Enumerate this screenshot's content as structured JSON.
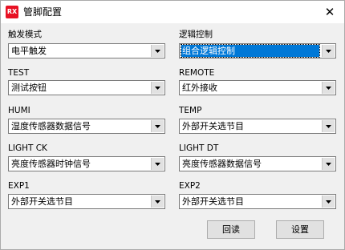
{
  "window": {
    "title": "管脚配置",
    "app_icon_text": "RX",
    "close_glyph": "✕"
  },
  "fields": {
    "trigger_mode": {
      "label": "触发模式",
      "value": "电平触发"
    },
    "logic_control": {
      "label": "逻辑控制",
      "value": "组合逻辑控制"
    },
    "test": {
      "label": "TEST",
      "value": "测试按钮"
    },
    "remote": {
      "label": "REMOTE",
      "value": "红外接收"
    },
    "humi": {
      "label": "HUMI",
      "value": "湿度传感器数据信号"
    },
    "temp": {
      "label": "TEMP",
      "value": "外部开关选节目"
    },
    "light_ck": {
      "label": "LIGHT CK",
      "value": "亮度传感器时钟信号"
    },
    "light_dt": {
      "label": "LIGHT DT",
      "value": "亮度传感器数据信号"
    },
    "exp1": {
      "label": "EXP1",
      "value": "外部开关选节目"
    },
    "exp2": {
      "label": "EXP2",
      "value": "外部开关选节目"
    }
  },
  "buttons": {
    "readback": "回读",
    "settings": "设置"
  },
  "icons": {
    "dropdown": "chevron-down-icon",
    "close": "close-icon"
  },
  "colors": {
    "selection": "#0078d7",
    "app_icon": "#e81123"
  }
}
